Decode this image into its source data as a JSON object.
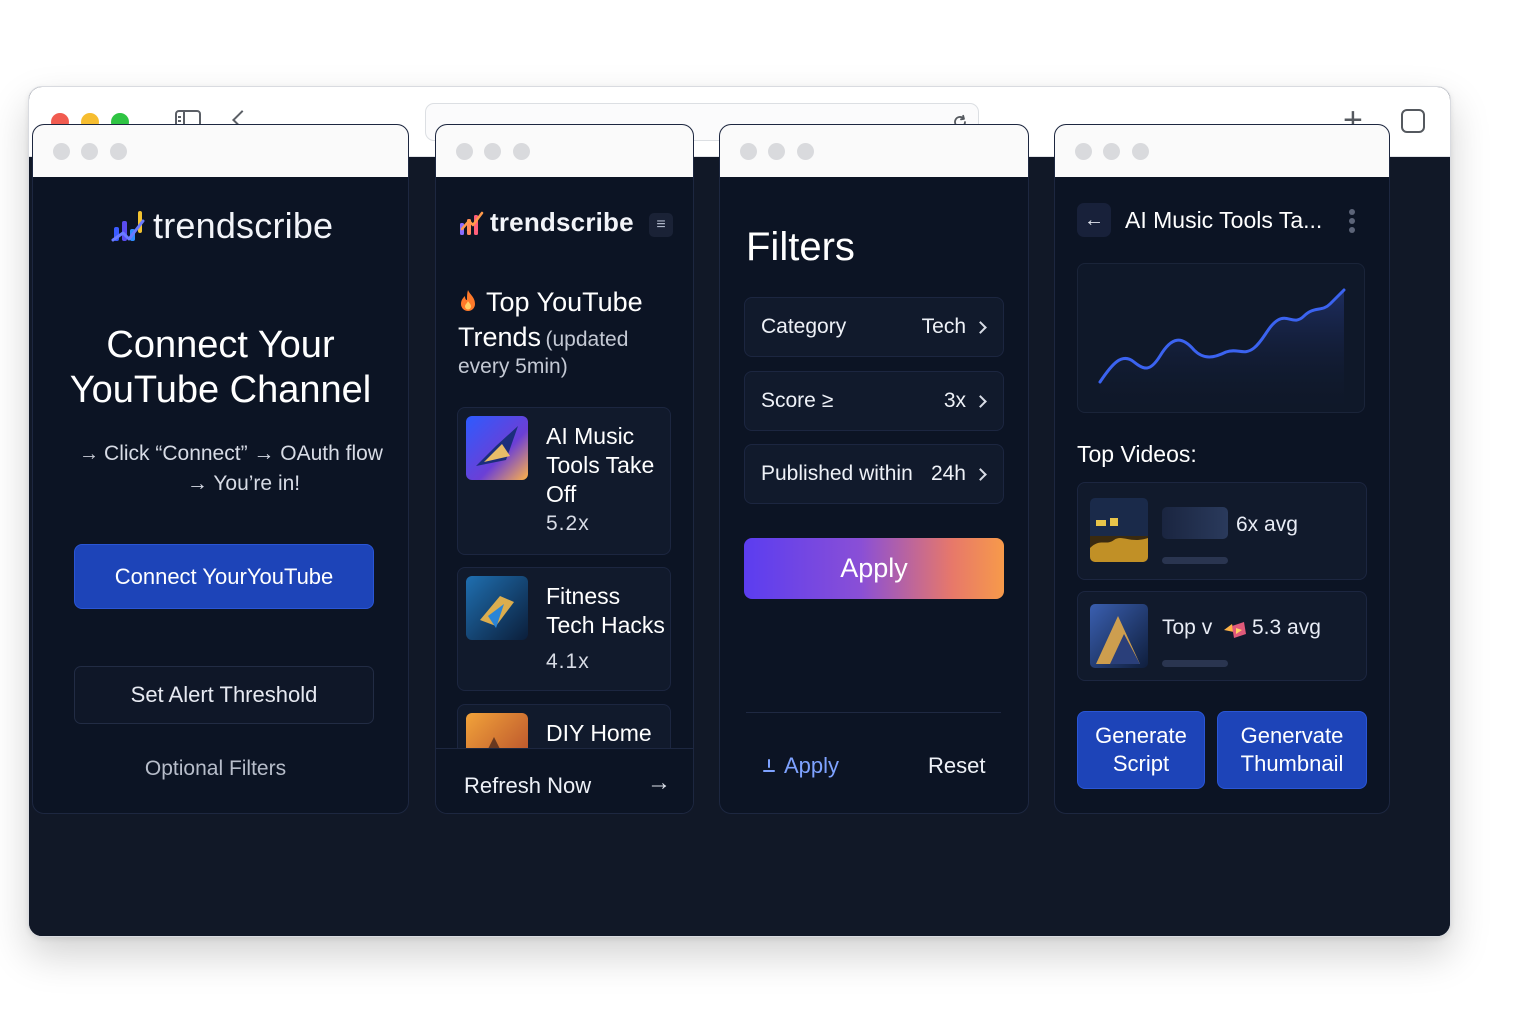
{
  "colors": {
    "accent": "#1d44b8",
    "background": "#111827",
    "panel": "#0c1424",
    "link": "#7ea2ff"
  },
  "brand": {
    "name": "trendscribe"
  },
  "connect_panel": {
    "title": "Connect Your YouTube Channel",
    "step": "Click “Connect” → OAuth flow → You’re in!",
    "connect_button": "Connect YourYouTube",
    "alert_button": "Set Alert Threshold",
    "optional_filters": "Optional Filters"
  },
  "trends_panel": {
    "heading": "Top YouTube Trends",
    "subheading": "(updated every 5min)",
    "items": [
      {
        "title": "AI Music Tools Take Off",
        "score": "5.2x"
      },
      {
        "title": "Fitness Tech Hacks",
        "score": "4.1x"
      },
      {
        "title": "DIY Home",
        "score": ""
      }
    ],
    "refresh_label": "Refresh Now",
    "refresh_icon": "arrow-right-icon"
  },
  "filters_panel": {
    "title": "Filters",
    "rows": [
      {
        "label": "Category",
        "value": "Tech"
      },
      {
        "label": "Score ≥",
        "value": "3x"
      },
      {
        "label": "Published within",
        "value": "24h"
      }
    ],
    "apply_button": "Apply",
    "apply_link": "Apply",
    "reset_link": "Reset"
  },
  "detail_panel": {
    "title": "AI Music Tools Ta...",
    "top_videos_label": "Top Videos:",
    "videos": [
      {
        "title": "",
        "multiplier": "6x avg"
      },
      {
        "title": "Top v",
        "multiplier": "5.3 avg"
      }
    ],
    "generate_script": "Generate Script",
    "generate_thumbnail": "Genervate Thumbnail"
  }
}
